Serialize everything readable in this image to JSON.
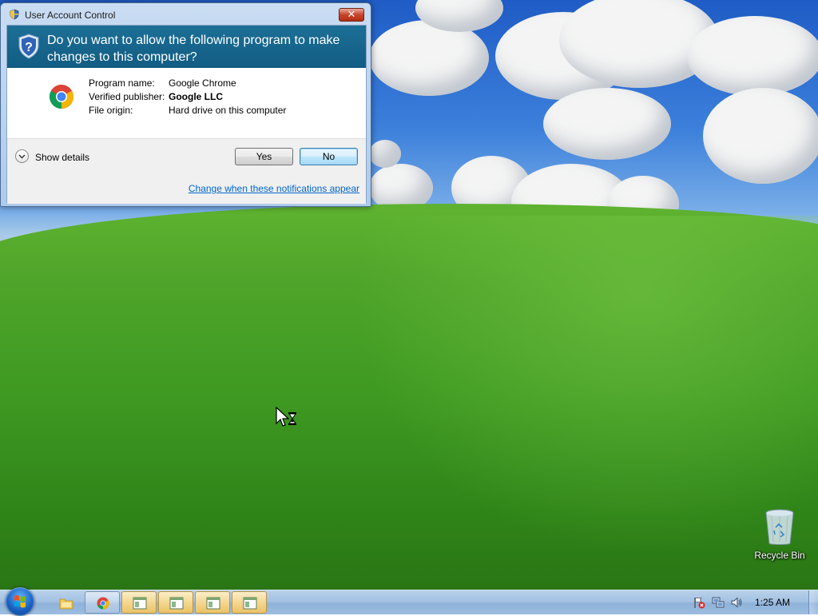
{
  "uac": {
    "window_title": "User Account Control",
    "question": "Do you want to allow the following program to make changes to this computer?",
    "program_name_label": "Program name:",
    "program_name_value": "Google Chrome",
    "publisher_label": "Verified publisher:",
    "publisher_value": "Google LLC",
    "origin_label": "File origin:",
    "origin_value": "Hard drive on this computer",
    "show_details_label": "Show details",
    "yes_label": "Yes",
    "no_label": "No",
    "change_link": "Change when these notifications appear",
    "close_glyph": "✕",
    "banner_color": "#15668e"
  },
  "desktop": {
    "recycle_bin_label": "Recycle Bin"
  },
  "taskbar": {
    "items": [
      {
        "name": "explorer",
        "icon": "folder-icon"
      },
      {
        "name": "chrome",
        "icon": "chrome-icon"
      },
      {
        "name": "window-1",
        "icon": "window-icon"
      },
      {
        "name": "window-2",
        "icon": "window-icon"
      },
      {
        "name": "window-3",
        "icon": "window-icon"
      },
      {
        "name": "window-4",
        "icon": "window-icon"
      }
    ],
    "clock": "1:25 AM"
  }
}
